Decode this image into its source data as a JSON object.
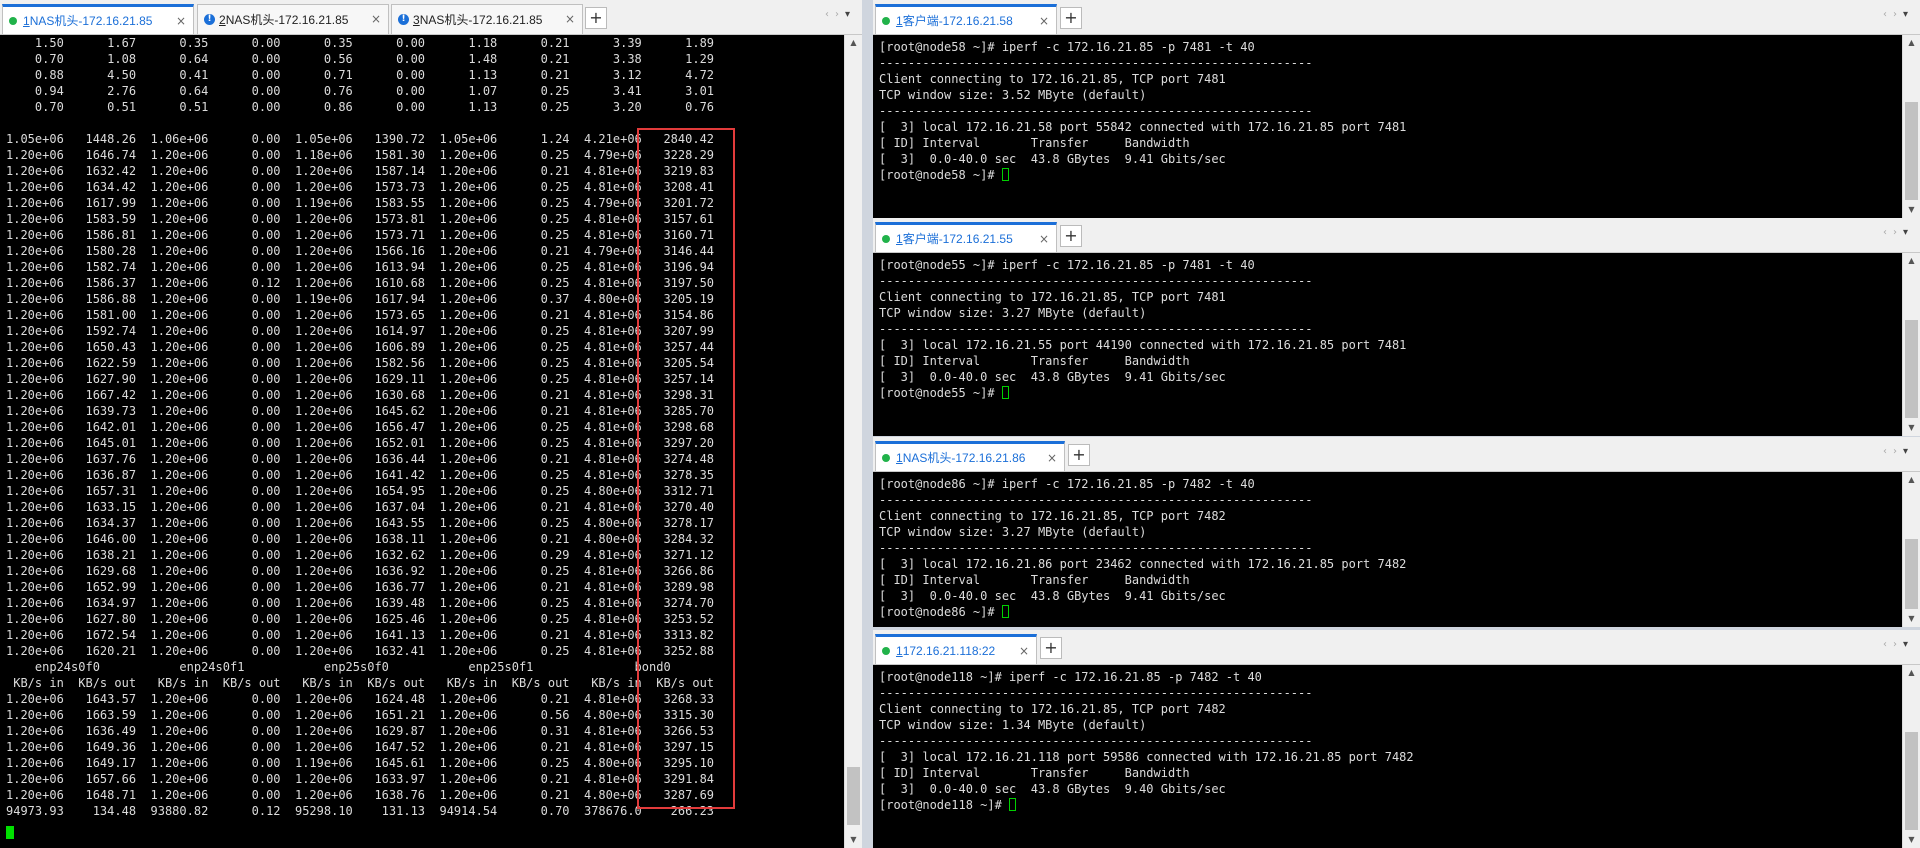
{
  "left": {
    "tabs": [
      {
        "num": "1",
        "title": "NAS机头-172.16.21.85",
        "icon": "green-dot",
        "close": "×"
      },
      {
        "num": "2",
        "title": "NAS机头-172.16.21.85",
        "icon": "info-icon",
        "close": "×"
      },
      {
        "num": "3",
        "title": "NAS机头-172.16.21.85",
        "icon": "info-icon",
        "close": "×"
      }
    ],
    "plus": "+",
    "lines": [
      "    1.50      1.67      0.35      0.00      0.35      0.00      1.18      0.21      3.39      1.89",
      "    0.70      1.08      0.64      0.00      0.56      0.00      1.48      0.21      3.38      1.29",
      "    0.88      4.50      0.41      0.00      0.71      0.00      1.13      0.21      3.12      4.72",
      "    0.94      2.76      0.64      0.00      0.76      0.00      1.07      0.25      3.41      3.01",
      "    0.70      0.51      0.51      0.00      0.86      0.00      1.13      0.25      3.20      0.76",
      "",
      "1.05e+06   1448.26  1.06e+06      0.00  1.05e+06   1390.72  1.05e+06      1.24  4.21e+06   2840.42",
      "1.20e+06   1646.74  1.20e+06      0.00  1.18e+06   1581.30  1.20e+06      0.25  4.79e+06   3228.29",
      "1.20e+06   1632.42  1.20e+06      0.00  1.20e+06   1587.14  1.20e+06      0.21  4.81e+06   3219.83",
      "1.20e+06   1634.42  1.20e+06      0.00  1.20e+06   1573.73  1.20e+06      0.25  4.81e+06   3208.41",
      "1.20e+06   1617.99  1.20e+06      0.00  1.19e+06   1583.55  1.20e+06      0.25  4.79e+06   3201.72",
      "1.20e+06   1583.59  1.20e+06      0.00  1.20e+06   1573.81  1.20e+06      0.25  4.81e+06   3157.61",
      "1.20e+06   1586.81  1.20e+06      0.00  1.20e+06   1573.71  1.20e+06      0.25  4.81e+06   3160.71",
      "1.20e+06   1580.28  1.20e+06      0.00  1.20e+06   1566.16  1.20e+06      0.21  4.79e+06   3146.44",
      "1.20e+06   1582.74  1.20e+06      0.00  1.20e+06   1613.94  1.20e+06      0.25  4.81e+06   3196.94",
      "1.20e+06   1586.37  1.20e+06      0.12  1.20e+06   1610.68  1.20e+06      0.25  4.81e+06   3197.50",
      "1.20e+06   1586.88  1.20e+06      0.00  1.19e+06   1617.94  1.20e+06      0.37  4.80e+06   3205.19",
      "1.20e+06   1581.00  1.20e+06      0.00  1.20e+06   1573.65  1.20e+06      0.21  4.81e+06   3154.86",
      "1.20e+06   1592.74  1.20e+06      0.00  1.20e+06   1614.97  1.20e+06      0.25  4.81e+06   3207.99",
      "1.20e+06   1650.43  1.20e+06      0.00  1.20e+06   1606.89  1.20e+06      0.25  4.81e+06   3257.44",
      "1.20e+06   1622.59  1.20e+06      0.00  1.20e+06   1582.56  1.20e+06      0.25  4.81e+06   3205.54",
      "1.20e+06   1627.90  1.20e+06      0.00  1.20e+06   1629.11  1.20e+06      0.25  4.81e+06   3257.14",
      "1.20e+06   1667.42  1.20e+06      0.00  1.20e+06   1630.68  1.20e+06      0.21  4.81e+06   3298.31",
      "1.20e+06   1639.73  1.20e+06      0.00  1.20e+06   1645.62  1.20e+06      0.21  4.81e+06   3285.70",
      "1.20e+06   1642.01  1.20e+06      0.00  1.20e+06   1656.47  1.20e+06      0.25  4.81e+06   3298.68",
      "1.20e+06   1645.01  1.20e+06      0.00  1.20e+06   1652.01  1.20e+06      0.25  4.81e+06   3297.20",
      "1.20e+06   1637.76  1.20e+06      0.00  1.20e+06   1636.44  1.20e+06      0.21  4.81e+06   3274.48",
      "1.20e+06   1636.87  1.20e+06      0.00  1.20e+06   1641.42  1.20e+06      0.25  4.81e+06   3278.35",
      "1.20e+06   1657.31  1.20e+06      0.00  1.20e+06   1654.95  1.20e+06      0.25  4.80e+06   3312.71",
      "1.20e+06   1633.15  1.20e+06      0.00  1.20e+06   1637.04  1.20e+06      0.21  4.81e+06   3270.40",
      "1.20e+06   1634.37  1.20e+06      0.00  1.20e+06   1643.55  1.20e+06      0.25  4.80e+06   3278.17",
      "1.20e+06   1646.00  1.20e+06      0.00  1.20e+06   1638.11  1.20e+06      0.21  4.80e+06   3284.32",
      "1.20e+06   1638.21  1.20e+06      0.00  1.20e+06   1632.62  1.20e+06      0.29  4.81e+06   3271.12",
      "1.20e+06   1629.68  1.20e+06      0.00  1.20e+06   1636.92  1.20e+06      0.25  4.81e+06   3266.86",
      "1.20e+06   1652.99  1.20e+06      0.00  1.20e+06   1636.77  1.20e+06      0.21  4.81e+06   3289.98",
      "1.20e+06   1634.97  1.20e+06      0.00  1.20e+06   1639.48  1.20e+06      0.25  4.81e+06   3274.70",
      "1.20e+06   1627.80  1.20e+06      0.00  1.20e+06   1625.46  1.20e+06      0.25  4.81e+06   3253.52",
      "1.20e+06   1672.54  1.20e+06      0.00  1.20e+06   1641.13  1.20e+06      0.21  4.81e+06   3313.82",
      "1.20e+06   1620.21  1.20e+06      0.00  1.20e+06   1632.41  1.20e+06      0.25  4.81e+06   3252.88",
      "    enp24s0f0           enp24s0f1           enp25s0f0           enp25s0f1              bond0",
      " KB/s in  KB/s out   KB/s in  KB/s out   KB/s in  KB/s out   KB/s in  KB/s out   KB/s in  KB/s out",
      "1.20e+06   1643.57  1.20e+06      0.00  1.20e+06   1624.48  1.20e+06      0.21  4.81e+06   3268.33",
      "1.20e+06   1663.59  1.20e+06      0.00  1.20e+06   1651.21  1.20e+06      0.56  4.80e+06   3315.30",
      "1.20e+06   1636.49  1.20e+06      0.00  1.20e+06   1629.87  1.20e+06      0.31  4.81e+06   3266.53",
      "1.20e+06   1649.36  1.20e+06      0.00  1.20e+06   1647.52  1.20e+06      0.21  4.81e+06   3297.15",
      "1.20e+06   1649.17  1.20e+06      0.00  1.19e+06   1645.61  1.20e+06      0.25  4.80e+06   3295.10",
      "1.20e+06   1657.66  1.20e+06      0.00  1.20e+06   1633.97  1.20e+06      0.21  4.81e+06   3291.84",
      "1.20e+06   1648.71  1.20e+06      0.00  1.20e+06   1638.76  1.20e+06      0.21  4.80e+06   3287.69",
      "94973.93    134.48  93880.82      0.12  95298.10    131.13  94914.54      0.70  378676.0    266.23"
    ]
  },
  "panes": [
    {
      "tab": {
        "num": "1",
        "title": "客户端-172.16.21.58"
      },
      "lines": [
        "[root@node58 ~]# iperf -c 172.16.21.85 -p 7481 -t 40",
        "------------------------------------------------------------",
        "Client connecting to 172.16.21.85, TCP port 7481",
        "TCP window size: 3.52 MByte (default)",
        "------------------------------------------------------------",
        "[  3] local 172.16.21.58 port 55842 connected with 172.16.21.85 port 7481",
        "[ ID] Interval       Transfer     Bandwidth",
        "[  3]  0.0-40.0 sec  43.8 GBytes  9.41 Gbits/sec",
        "[root@node58 ~]# "
      ]
    },
    {
      "tab": {
        "num": "1",
        "title": "客户端-172.16.21.55"
      },
      "lines": [
        "[root@node55 ~]# iperf -c 172.16.21.85 -p 7481 -t 40",
        "------------------------------------------------------------",
        "Client connecting to 172.16.21.85, TCP port 7481",
        "TCP window size: 3.27 MByte (default)",
        "------------------------------------------------------------",
        "[  3] local 172.16.21.55 port 44190 connected with 172.16.21.85 port 7481",
        "[ ID] Interval       Transfer     Bandwidth",
        "[  3]  0.0-40.0 sec  43.8 GBytes  9.41 Gbits/sec",
        "[root@node55 ~]# "
      ]
    },
    {
      "tab": {
        "num": "1",
        "title": "NAS机头-172.16.21.86"
      },
      "lines": [
        "[root@node86 ~]# iperf -c 172.16.21.85 -p 7482 -t 40",
        "------------------------------------------------------------",
        "Client connecting to 172.16.21.85, TCP port 7482",
        "TCP window size: 3.27 MByte (default)",
        "------------------------------------------------------------",
        "[  3] local 172.16.21.86 port 23462 connected with 172.16.21.85 port 7482",
        "[ ID] Interval       Transfer     Bandwidth",
        "[  3]  0.0-40.0 sec  43.8 GBytes  9.41 Gbits/sec",
        "[root@node86 ~]# "
      ]
    },
    {
      "tab": {
        "num": "1",
        "title": "172.16.21.118:22"
      },
      "lines": [
        "[root@node118 ~]# iperf -c 172.16.21.85 -p 7482 -t 40",
        "------------------------------------------------------------",
        "Client connecting to 172.16.21.85, TCP port 7482",
        "TCP window size: 1.34 MByte (default)",
        "------------------------------------------------------------",
        "[  3] local 172.16.21.118 port 59586 connected with 172.16.21.85 port 7482",
        "[ ID] Interval       Transfer     Bandwidth",
        "[  3]  0.0-40.0 sec  43.8 GBytes  9.40 Gbits/sec",
        "[root@node118 ~]# "
      ]
    }
  ],
  "ui": {
    "close": "×",
    "plus": "+",
    "prev": "‹",
    "next": "›",
    "menu": "▾",
    "up": "▲",
    "down": "▼"
  },
  "colors": {
    "tab_active": "#1b6fd8",
    "status_dot": "#21b24a",
    "highlight_box": "#e23b3b",
    "terminal_bg": "#000000"
  }
}
